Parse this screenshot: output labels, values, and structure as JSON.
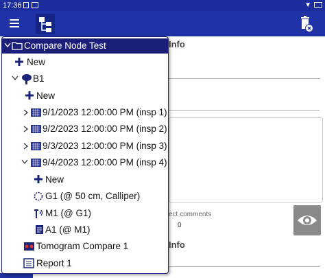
{
  "status_bar": {
    "time": "17:36"
  },
  "tree": {
    "root": "Compare Node Test",
    "items": [
      {
        "label": "New"
      },
      {
        "label": "B1"
      },
      {
        "label": "New"
      },
      {
        "label": "9/1/2023 12:00:00 PM (insp 1)"
      },
      {
        "label": "9/2/2023 12:00:00 PM (insp 2)"
      },
      {
        "label": "9/3/2023 12:00:00 PM (insp 3)"
      },
      {
        "label": "9/4/2023 12:00:00 PM (insp 4)"
      },
      {
        "label": "New"
      },
      {
        "label": "G1 (@ 50 cm, Calliper)"
      },
      {
        "label": "M1 (@ G1)"
      },
      {
        "label": "A1 (@ M1)"
      },
      {
        "label": "Tomogram Compare 1"
      },
      {
        "label": "Report 1"
      }
    ]
  },
  "background": {
    "section_title_1": "Info",
    "comments_label": "ect comments",
    "comments_count": "0",
    "section_title_2": "Info"
  },
  "colors": {
    "app_bar": "#1f33a6",
    "selected_row": "#1b1f7a",
    "calendar_icon": "#2a3590"
  }
}
